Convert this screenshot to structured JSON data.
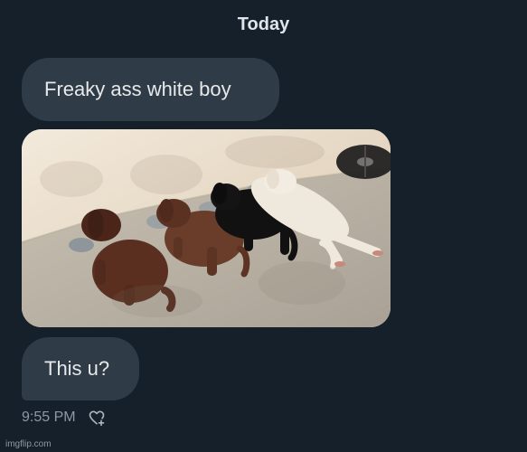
{
  "conversation": {
    "date_label": "Today",
    "messages": [
      {
        "text": "Freaky ass white boy"
      },
      {
        "image_alt": "Four puppies eating from bowls, one white puppy lying flat"
      },
      {
        "text": "This u?"
      }
    ],
    "timestamp": "9:55 PM"
  },
  "icons": {
    "react": "heart-plus-icon"
  },
  "watermark": "imgflip.com",
  "colors": {
    "background": "#15202b",
    "bubble": "#2f3b46",
    "text": "#e7e9ea",
    "muted_text": "#8b98a5"
  }
}
